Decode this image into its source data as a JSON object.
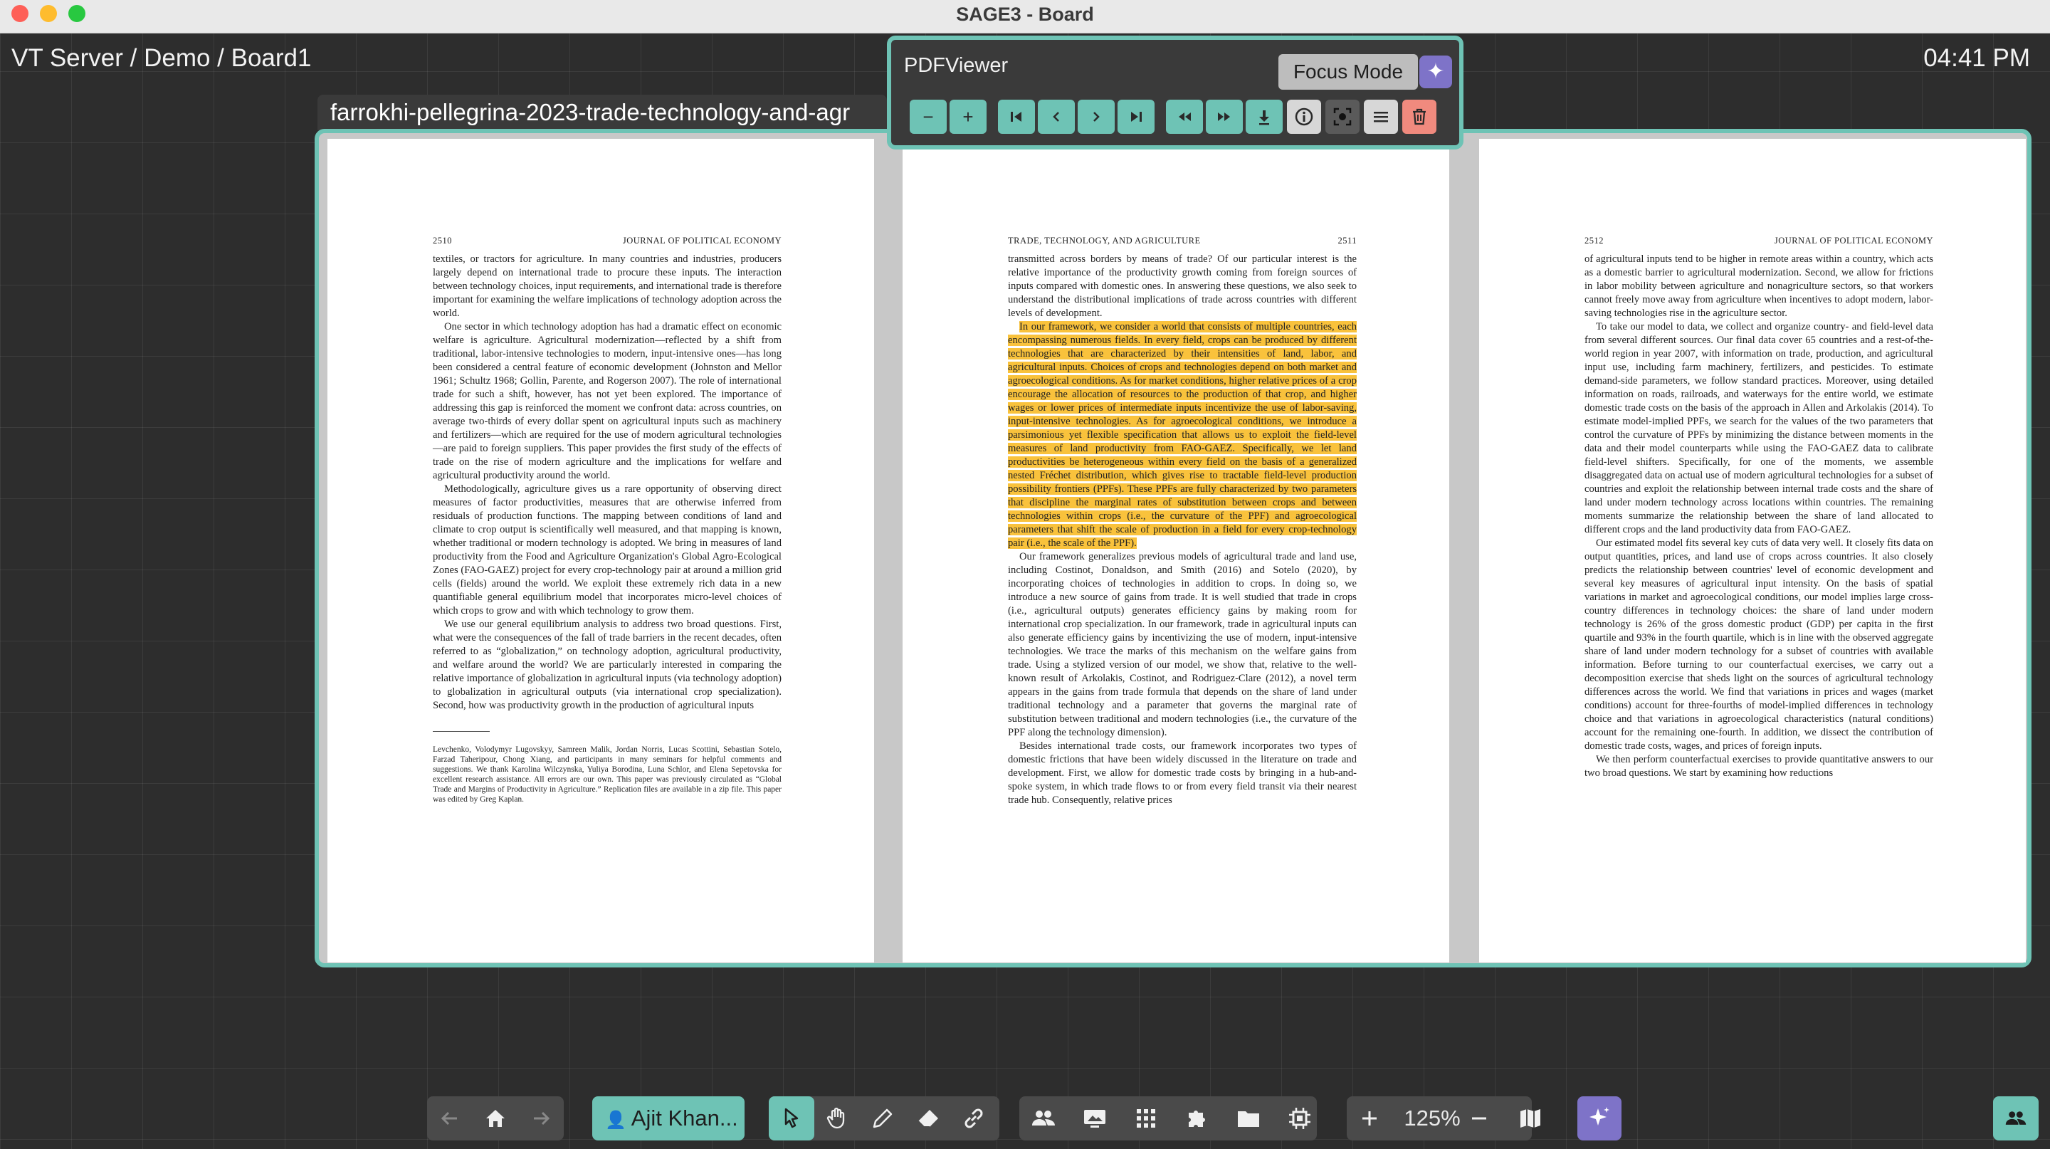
{
  "window": {
    "title": "SAGE3 - Board"
  },
  "board": {
    "path": "VT Server / Demo / Board1",
    "clock": "04:41 PM"
  },
  "app": {
    "file_title": "farrokhi-pellegrina-2023-trade-technology-and-agr",
    "panel_title": "PDFViewer",
    "tooltip": "Focus Mode",
    "toolbar": {
      "zoom_out": "−",
      "zoom_in": "+"
    }
  },
  "pages": [
    {
      "number": "2510",
      "running_head": "JOURNAL OF POLITICAL ECONOMY",
      "paragraphs": [
        "textiles, or tractors for agriculture. In many countries and industries, producers largely depend on international trade to procure these inputs. The interaction between technology choices, input requirements, and international trade is therefore important for examining the welfare implications of technology adoption across the world.",
        "One sector in which technology adoption has had a dramatic effect on economic welfare is agriculture. Agricultural modernization—reflected by a shift from traditional, labor-intensive technologies to modern, input-intensive ones—has long been considered a central feature of economic development (Johnston and Mellor 1961; Schultz 1968; Gollin, Parente, and Rogerson 2007). The role of international trade for such a shift, however, has not yet been explored. The importance of addressing this gap is reinforced the moment we confront data: across countries, on average two-thirds of every dollar spent on agricultural inputs such as machinery and fertilizers—which are required for the use of modern agricultural technologies—are paid to foreign suppliers. This paper provides the first study of the effects of trade on the rise of modern agriculture and the implications for welfare and agricultural productivity around the world.",
        "Methodologically, agriculture gives us a rare opportunity of observing direct measures of factor productivities, measures that are otherwise inferred from residuals of production functions. The mapping between conditions of land and climate to crop output is scientifically well measured, and that mapping is known, whether traditional or modern technology is adopted. We bring in measures of land productivity from the Food and Agriculture Organization's Global Agro-Ecological Zones (FAO-GAEZ) project for every crop-technology pair at around a million grid cells (fields) around the world. We exploit these extremely rich data in a new quantifiable general equilibrium model that incorporates micro-level choices of which crops to grow and with which technology to grow them.",
        "We use our general equilibrium analysis to address two broad questions. First, what were the consequences of the fall of trade barriers in the recent decades, often referred to as “globalization,” on technology adoption, agricultural productivity, and welfare around the world? We are particularly interested in comparing the relative importance of globalization in agricultural inputs (via technology adoption) to globalization in agricultural outputs (via international crop specialization). Second, how was productivity growth in the production of agricultural inputs"
      ],
      "footnote": "Levchenko, Volodymyr Lugovskyy, Samreen Malik, Jordan Norris, Lucas Scottini, Sebastian Sotelo, Farzad Taheripour, Chong Xiang, and participants in many seminars for helpful comments and suggestions. We thank Karolina Wilczynska, Yuliya Borodina, Luna Schlor, and Elena Sepetovska for excellent research assistance. All errors are our own. This paper was previously circulated as “Global Trade and Margins of Productivity in Agriculture.” Replication files are available in a zip file. This paper was edited by Greg Kaplan."
    },
    {
      "number": "2511",
      "running_head": "TRADE, TECHNOLOGY, AND AGRICULTURE",
      "lead": "transmitted across borders by means of trade? Of our particular interest is the relative importance of the productivity growth coming from foreign sources of inputs compared with domestic ones. In answering these questions, we also seek to understand the distributional implications of trade across countries with different levels of development.",
      "highlight": "In our framework, we consider a world that consists of multiple countries, each encompassing numerous fields. In every field, crops can be produced by different technologies that are characterized by their intensities of land, labor, and agricultural inputs. Choices of crops and technologies depend on both market and agroecological conditions. As for market conditions, higher relative prices of a crop encourage the allocation of resources to the production of that crop, and higher wages or lower prices of intermediate inputs incentivize the use of labor-saving, input-intensive technologies. As for agroecological conditions, we introduce a parsimonious yet flexible specification that allows us to exploit the field-level measures of land productivity from FAO-GAEZ. Specifically, we let land productivities be heterogeneous within every field on the basis of a generalized nested Fréchet distribution, which gives rise to tractable field-level production possibility frontiers (PPFs). These PPFs are fully characterized by two parameters that discipline the marginal rates of substitution between crops and between technologies within crops (i.e., the curvature of the PPF) and agroecological parameters that shift the scale of production in a field for every crop-technology pair (i.e., the scale of the PPF).",
      "paragraphs": [
        "Our framework generalizes previous models of agricultural trade and land use, including Costinot, Donaldson, and Smith (2016) and Sotelo (2020), by incorporating choices of technologies in addition to crops. In doing so, we introduce a new source of gains from trade. It is well studied that trade in crops (i.e., agricultural outputs) generates efficiency gains by making room for international crop specialization. In our framework, trade in agricultural inputs can also generate efficiency gains by incentivizing the use of modern, input-intensive technologies. We trace the marks of this mechanism on the welfare gains from trade. Using a stylized version of our model, we show that, relative to the well-known result of Arkolakis, Costinot, and Rodriguez-Clare (2012), a novel term appears in the gains from trade formula that depends on the share of land under traditional technology and a parameter that governs the marginal rate of substitution between traditional and modern technologies (i.e., the curvature of the PPF along the technology dimension).",
        "Besides international trade costs, our framework incorporates two types of domestic frictions that have been widely discussed in the literature on trade and development. First, we allow for domestic trade costs by bringing in a hub-and-spoke system, in which trade flows to or from every field transit via their nearest trade hub. Consequently, relative prices"
      ]
    },
    {
      "number": "2512",
      "running_head": "JOURNAL OF POLITICAL ECONOMY",
      "paragraphs": [
        "of agricultural inputs tend to be higher in remote areas within a country, which acts as a domestic barrier to agricultural modernization. Second, we allow for frictions in labor mobility between agriculture and nonagriculture sectors, so that workers cannot freely move away from agriculture when incentives to adopt modern, labor-saving technologies rise in the agriculture sector.",
        "To take our model to data, we collect and organize country- and field-level data from several different sources. Our final data cover 65 countries and a rest-of-the-world region in year 2007, with information on trade, production, and agricultural input use, including farm machinery, fertilizers, and pesticides. To estimate demand-side parameters, we follow standard practices. Moreover, using detailed information on roads, railroads, and waterways for the entire world, we estimate domestic trade costs on the basis of the approach in Allen and Arkolakis (2014). To estimate model-implied PPFs, we search for the values of the two parameters that control the curvature of PPFs by minimizing the distance between moments in the data and their model counterparts while using the FAO-GAEZ data to calibrate field-level shifters. Specifically, for one of the moments, we assemble disaggregated data on actual use of modern agricultural technologies for a subset of countries and exploit the relationship between internal trade costs and the share of land under modern technology across locations within countries. The remaining moments summarize the relationship between the share of land allocated to different crops and the land productivity data from FAO-GAEZ.",
        "Our estimated model fits several key cuts of data very well. It closely fits data on output quantities, prices, and land use of crops across countries. It also closely predicts the relationship between countries' level of economic development and several key measures of agricultural input intensity. On the basis of spatial variations in market and agroecological conditions, our model implies large cross-country differences in technology choices: the share of land under modern technology is 26% of the gross domestic product (GDP) per capita in the first quartile and 93% in the fourth quartile, which is in line with the observed aggregate share of land under modern technology for a subset of countries with available information. Before turning to our counterfactual exercises, we carry out a decomposition exercise that sheds light on the sources of agricultural technology differences across the world. We find that variations in prices and wages (market conditions) account for three-fourths of model-implied differences in technology choice and that variations in agroecological characteristics (natural conditions) account for the remaining one-fourth. In addition, we dissect the contribution of domestic trade costs, wages, and prices of foreign inputs.",
        "We then perform counterfactual exercises to provide quantitative answers to our two broad questions. We start by examining how reductions"
      ]
    }
  ],
  "dock": {
    "user_name": "Ajit Khan...",
    "zoom": "125%"
  },
  "colors": {
    "accent": "#6ec3b5",
    "ai": "#7e73c8",
    "delete": "#f08a7e",
    "highlight": "#f9c23c"
  },
  "icons": [
    "back-arrow-icon",
    "home-icon",
    "forward-arrow-icon",
    "user-icon",
    "pointer-icon",
    "hand-icon",
    "pencil-icon",
    "eraser-icon",
    "link-icon",
    "users-icon",
    "screenshare-icon",
    "apps-grid-icon",
    "plugin-icon",
    "folder-icon",
    "layout-fit-icon",
    "zoom-in-icon",
    "zoom-out-icon",
    "map-icon",
    "sparkle-icon",
    "first-page-icon",
    "prev-page-icon",
    "next-page-icon",
    "last-page-icon",
    "rewind-icon",
    "fast-forward-icon",
    "download-icon",
    "info-icon",
    "focus-mode-icon",
    "menu-icon",
    "trash-icon"
  ]
}
